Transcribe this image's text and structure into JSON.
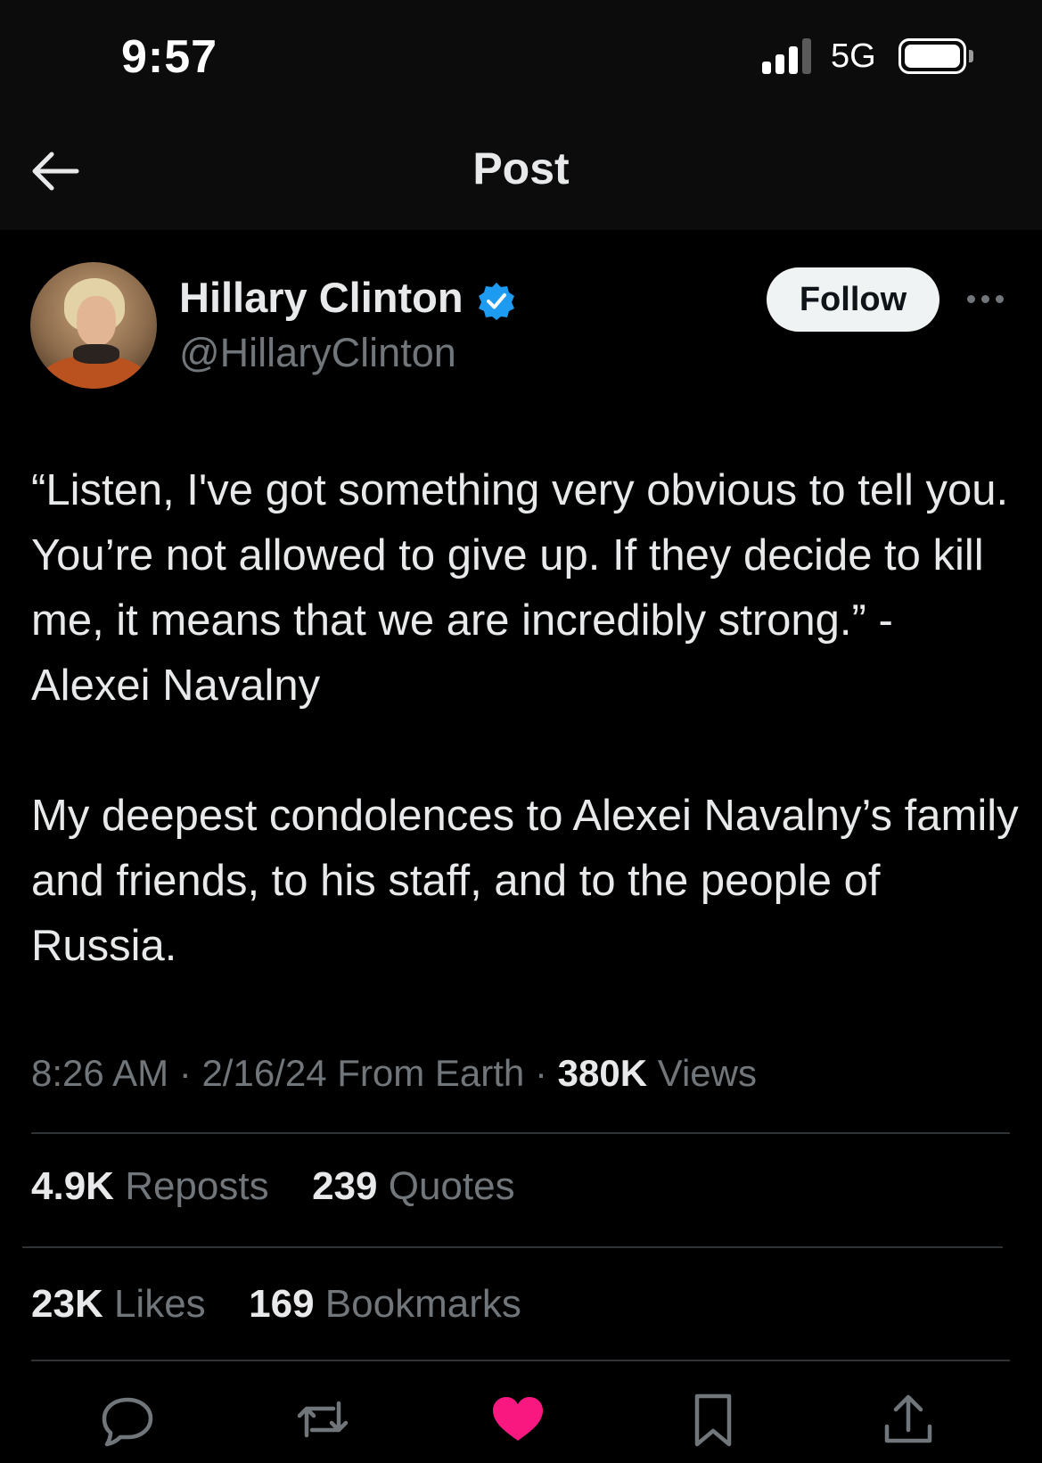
{
  "status_bar": {
    "time": "9:57",
    "network": "5G",
    "signal_bars_filled": 3,
    "signal_bars_total": 4
  },
  "header": {
    "title": "Post",
    "back_icon": "arrow-left-icon"
  },
  "author": {
    "display_name": "Hillary Clinton",
    "handle": "@HillaryClinton",
    "verified_icon": "verified-badge-icon",
    "follow_label": "Follow",
    "more_icon": "more-dots-icon"
  },
  "tweet": {
    "paragraphs": [
      "“Listen, I've got something very obvious to tell you. You’re not allowed to give up. If they decide to kill me, it means that we are incredibly strong.” - Alexei Navalny",
      "My deepest condolences to Alexei Navalny’s family and friends, to his staff, and to the people of Russia."
    ],
    "time": "8:26 AM",
    "date": "2/16/24",
    "source": "From Earth",
    "views_count": "380K",
    "views_label": "Views"
  },
  "stats": {
    "reposts_count": "4.9K",
    "reposts_label": "Reposts",
    "quotes_count": "239",
    "quotes_label": "Quotes",
    "likes_count": "23K",
    "likes_label": "Likes",
    "bookmarks_count": "169",
    "bookmarks_label": "Bookmarks"
  },
  "actions": [
    {
      "icon": "reply-icon"
    },
    {
      "icon": "repost-icon"
    },
    {
      "icon": "like-icon",
      "active": true
    },
    {
      "icon": "bookmark-icon"
    },
    {
      "icon": "share-icon"
    }
  ],
  "colors": {
    "background": "#000000",
    "text": "#e7e9ea",
    "secondary_text": "#71767b",
    "verified": "#1d9bf0",
    "like_active": "#f91880",
    "follow_button_bg": "#eff3f4"
  }
}
